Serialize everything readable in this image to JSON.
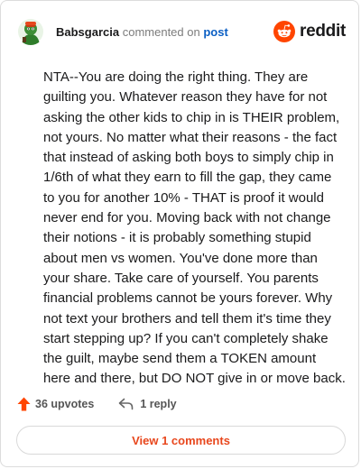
{
  "comment": {
    "username": "Babsgarcia",
    "action_text": "commented on",
    "target_text": "post",
    "body": "NTA--You are doing the right thing. They are guilting you. Whatever reason they have for not asking the other kids to chip in is THEIR problem, not yours. No matter what their reasons - the fact that instead of asking both boys to simply chip in 1/6th of what they earn to fill the gap, they came to you for another 10% - THAT is proof it would never end for you. Moving back with not change their notions - it is probably something stupid about men vs women. You've done more than your share. Take care of yourself. You parents financial problems cannot be yours forever. Why not text your brothers and tell them it's time they start stepping up? If you can't completely shake the guilt, maybe send them a TOKEN amount here and there, but DO NOT give in or move back."
  },
  "brand": {
    "name": "reddit",
    "icon": "reddit-logo-icon",
    "color": "#ff4500"
  },
  "actions": {
    "upvotes_label": "36 upvotes",
    "upvote_icon": "upvote-arrow-icon",
    "upvote_color": "#ff4500",
    "reply_label": "1 reply",
    "reply_icon": "reply-arrow-icon"
  },
  "footer": {
    "view_comments_label": "View 1 comments",
    "accent_color": "#e8471d"
  },
  "colors": {
    "link": "#0b5fc4",
    "muted": "#7c7c7c",
    "text": "#1a1a1b"
  }
}
